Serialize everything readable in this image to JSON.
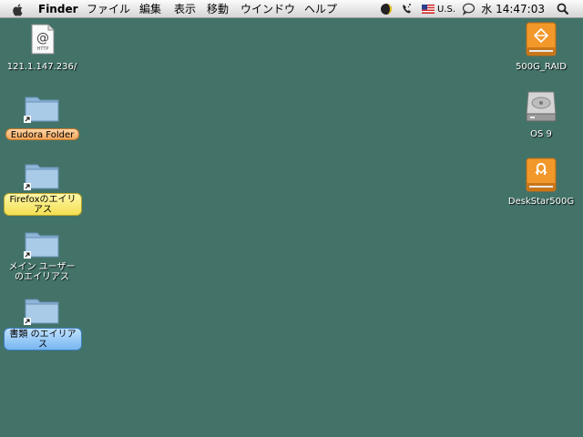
{
  "menubar": {
    "app_name": "Finder",
    "menus": [
      "ファイル",
      "編集",
      "表示",
      "移動",
      "ウインドウ",
      "ヘルプ"
    ],
    "input_locale": "U.S.",
    "clock": "水 14:47:03"
  },
  "desktop_left": [
    {
      "label": "121.1.147.236/",
      "kind": "http-location",
      "label_style": "none"
    },
    {
      "label": "Eudora Folder",
      "kind": "folder-alias",
      "label_style": "orange"
    },
    {
      "label_line1": "Firefoxのエイリ",
      "label_line2": "アス",
      "kind": "folder-alias",
      "label_style": "yellow"
    },
    {
      "label_line1": "メイン ユーザー",
      "label_line2": "のエイリアス",
      "kind": "folder-alias",
      "label_style": "none"
    },
    {
      "label_line1": "書類 のエイリア",
      "label_line2": "ス",
      "kind": "folder-alias",
      "label_style": "blue"
    }
  ],
  "desktop_right": [
    {
      "label": "500G_RAID",
      "kind": "firewire-drive"
    },
    {
      "label": "OS 9",
      "kind": "internal-hard-drive"
    },
    {
      "label": "DeskStar500G",
      "kind": "firewire-drive"
    }
  ],
  "colors": {
    "desktop": "#437368",
    "label_orange": "#f2a65b",
    "label_yellow": "#f3e052",
    "label_blue": "#77b6f0"
  }
}
